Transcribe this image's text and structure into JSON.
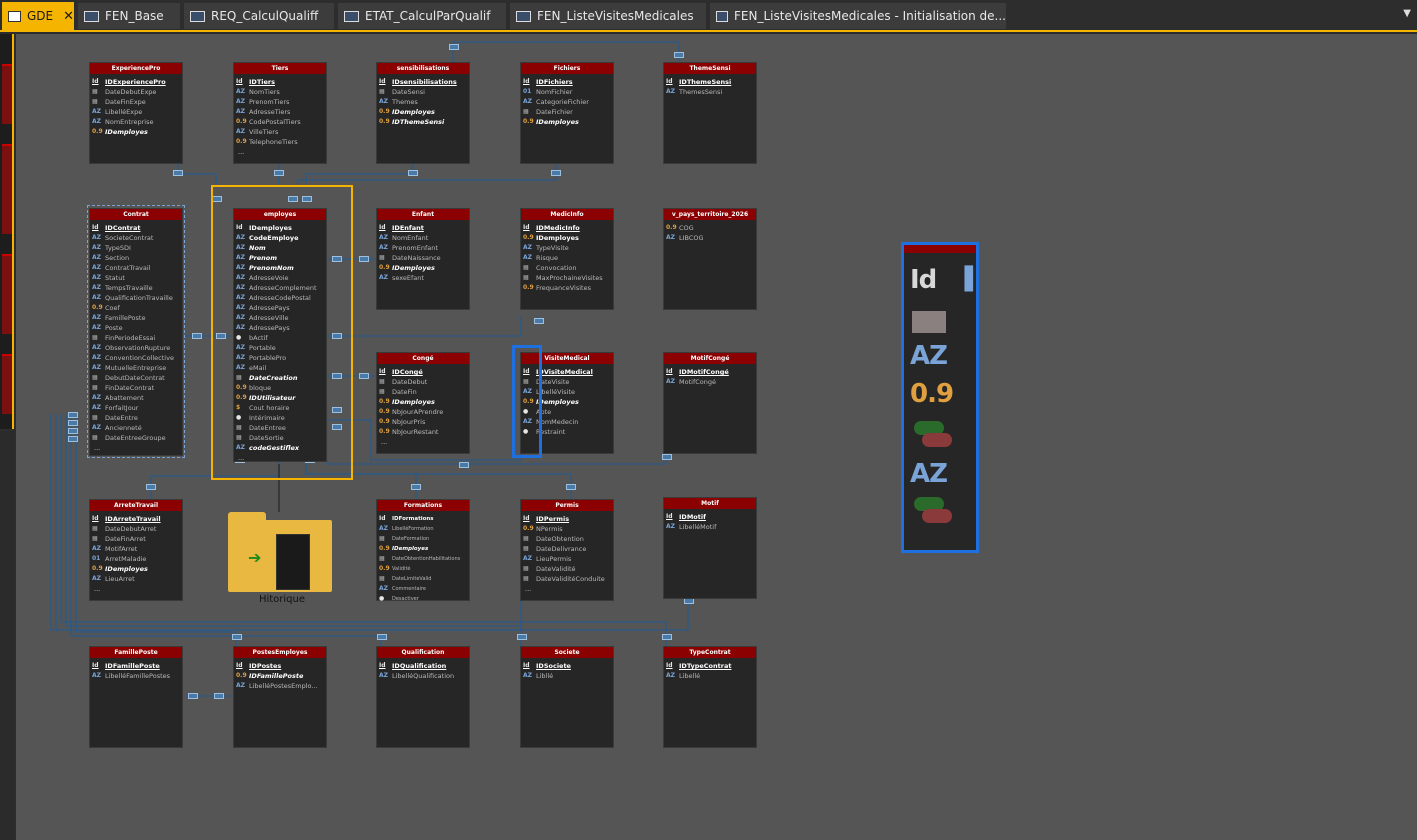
{
  "tabs": [
    {
      "label": "GDE",
      "active": true,
      "close": "✕"
    },
    {
      "label": "FEN_Base"
    },
    {
      "label": "REQ_CalculQualiff"
    },
    {
      "label": "ETAT_CalculParQualif"
    },
    {
      "label": "FEN_ListeVisitesMedicales"
    },
    {
      "label": "FEN_ListeVisitesMedicales - Initialisation de..."
    }
  ],
  "tables": {
    "experiencepro": {
      "title": "ExperiencePro",
      "fields": [
        "IDExperiencePro",
        "DateDebutExpe",
        "DateFinExpe",
        "LibelléExpe",
        "NomEntreprise",
        "IDemployes"
      ]
    },
    "tiers": {
      "title": "Tiers",
      "fields": [
        "IDTiers",
        "NomTiers",
        "PrenomTiers",
        "AdresseTiers",
        "CodePostalTiers",
        "VilleTiers",
        "TelephoneTiers",
        "..."
      ]
    },
    "sensibilisations": {
      "title": "sensibilisations",
      "fields": [
        "IDsensibilisations",
        "DateSensi",
        "Themes",
        "IDemployes",
        "IDThemeSensi"
      ]
    },
    "fichiers": {
      "title": "Fichiers",
      "fields": [
        "IDFichiers",
        "NomFichier",
        "CategorieFichier",
        "DateFichier",
        "IDemployes"
      ]
    },
    "themesensi": {
      "title": "ThemeSensi",
      "fields": [
        "IDThemeSensi",
        "ThemesSensi"
      ]
    },
    "contrat": {
      "title": "Contrat",
      "fields": [
        "IDContrat",
        "SocieteContrat",
        "TypeSDI",
        "Section",
        "ContratTravail",
        "Statut",
        "TempsTravaille",
        "QualificationTravaille",
        "Coef",
        "FamillePoste",
        "Poste",
        "FinPeriodeEssai",
        "ObservationRupture",
        "ConventionCollective",
        "MutuelleEntreprise",
        "DebutDateContrat",
        "FinDateContrat",
        "Abattement",
        "ForfaitJour",
        "DateEntre",
        "Ancienneté",
        "DateEntreeGroupe",
        "..."
      ]
    },
    "employes": {
      "title": "employes",
      "fields": [
        "IDemployes",
        "CodeEmploye",
        "Nom",
        "Prenom",
        "PrenomNom",
        "AdresseVoie",
        "AdresseComplement",
        "AdresseCodePostal",
        "AdressePays",
        "AdresseVille",
        "AdressePays",
        "bActif",
        "Portable",
        "PortablePro",
        "eMail",
        "DateCreation",
        "bloque",
        "IDUtilisateur",
        "Cout horaire",
        "Intérimaire",
        "DateEntree",
        "DateSortie",
        "codeGestiflex",
        "..."
      ]
    },
    "enfant": {
      "title": "Enfant",
      "fields": [
        "IDEnfant",
        "NomEnfant",
        "PrenomEnfant",
        "DateNaissance",
        "IDemployes",
        "sexeEfant"
      ]
    },
    "medicinfo": {
      "title": "MedicInfo",
      "fields": [
        "IDMedicInfo",
        "IDemployes",
        "TypeVisite",
        "Risque",
        "Convocation",
        "MaxProchaineVisites",
        "FrequanceVisites"
      ]
    },
    "vpays": {
      "title": "v_pays_territoire_2026",
      "fields": [
        "COG",
        "LIBCOG"
      ]
    },
    "conge": {
      "title": "Congé",
      "fields": [
        "IDCongé",
        "DateDebut",
        "DateFin",
        "IDemployes",
        "NbJourAPrendre",
        "NbJourPris",
        "NbJourRestant",
        "..."
      ]
    },
    "visitemedical": {
      "title": "VisiteMedical",
      "fields": [
        "IDVisiteMedical",
        "DateVisite",
        "LibelléVisite",
        "IDemployes",
        "Apte",
        "NomMedecin",
        "Restraint"
      ]
    },
    "motifconge": {
      "title": "MotifCongé",
      "fields": [
        "IDMotifCongé",
        "MotifCongé"
      ]
    },
    "arretravail": {
      "title": "ArreteTravail",
      "fields": [
        "IDArreteTravail",
        "DateDebutArret",
        "DateFinArret",
        "MotifArret",
        "ArretMaladie",
        "IDemployes",
        "LieuArret",
        "..."
      ]
    },
    "formations": {
      "title": "Formations",
      "fields": [
        "IDFormations",
        "LibelléFormation",
        "DateFormation",
        "IDemployes",
        "DateObtentionHabilitations",
        "Validité",
        "DateLimiteValid",
        "Commentaire",
        "Desactiver"
      ]
    },
    "permis": {
      "title": "Permis",
      "fields": [
        "IDPermis",
        "NPermis",
        "DateObtention",
        "DateDelivrance",
        "LieuPermis",
        "DateValidité",
        "DateValiditéConduite",
        "..."
      ]
    },
    "motif": {
      "title": "Motif",
      "fields": [
        "IDMotif",
        "LibelléMotif"
      ]
    },
    "familleposte": {
      "title": "FamillePoste",
      "fields": [
        "IDFamillePoste",
        "LibelléFamillePostes"
      ]
    },
    "postesemployes": {
      "title": "PostesEmployes",
      "fields": [
        "IDPostes",
        "IDFamillePoste",
        "LibelléPostesEmplo..."
      ]
    },
    "qualification": {
      "title": "Qualification",
      "fields": [
        "IDQualification",
        "LibelléQualification"
      ]
    },
    "societe": {
      "title": "Societe",
      "fields": [
        "IDSociete",
        "Libllé"
      ]
    },
    "typecontrat": {
      "title": "TypeContrat",
      "fields": [
        "IDTypeContrat",
        "Libellé"
      ]
    }
  },
  "folder": {
    "label": "Hitorique"
  },
  "zoom_preview": {
    "rows": [
      "Id",
      "AZ",
      "0.9",
      "AZ"
    ]
  }
}
